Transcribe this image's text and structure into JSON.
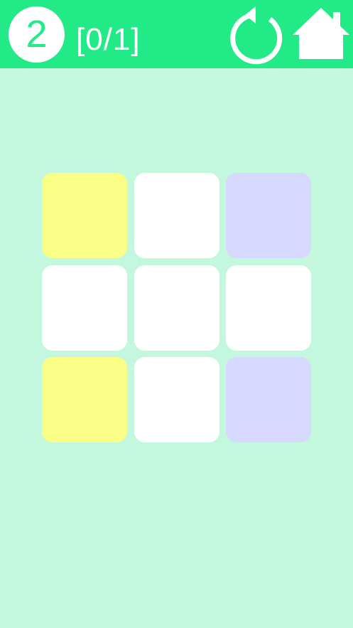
{
  "header": {
    "level": "2",
    "progress": "[0/1]",
    "restart_icon": "restart-icon",
    "home_icon": "home-icon"
  },
  "colors": {
    "header_bg": "#22ea86",
    "page_bg": "#c4f8de",
    "yellow": "#f9fe87",
    "white": "#ffffff",
    "lavender": "#d7d8fe"
  },
  "board": {
    "rows": 3,
    "cols": 3,
    "tiles": [
      [
        "yellow",
        "white",
        "lavender"
      ],
      [
        "white",
        "white",
        "white"
      ],
      [
        "yellow",
        "white",
        "lavender"
      ]
    ]
  }
}
